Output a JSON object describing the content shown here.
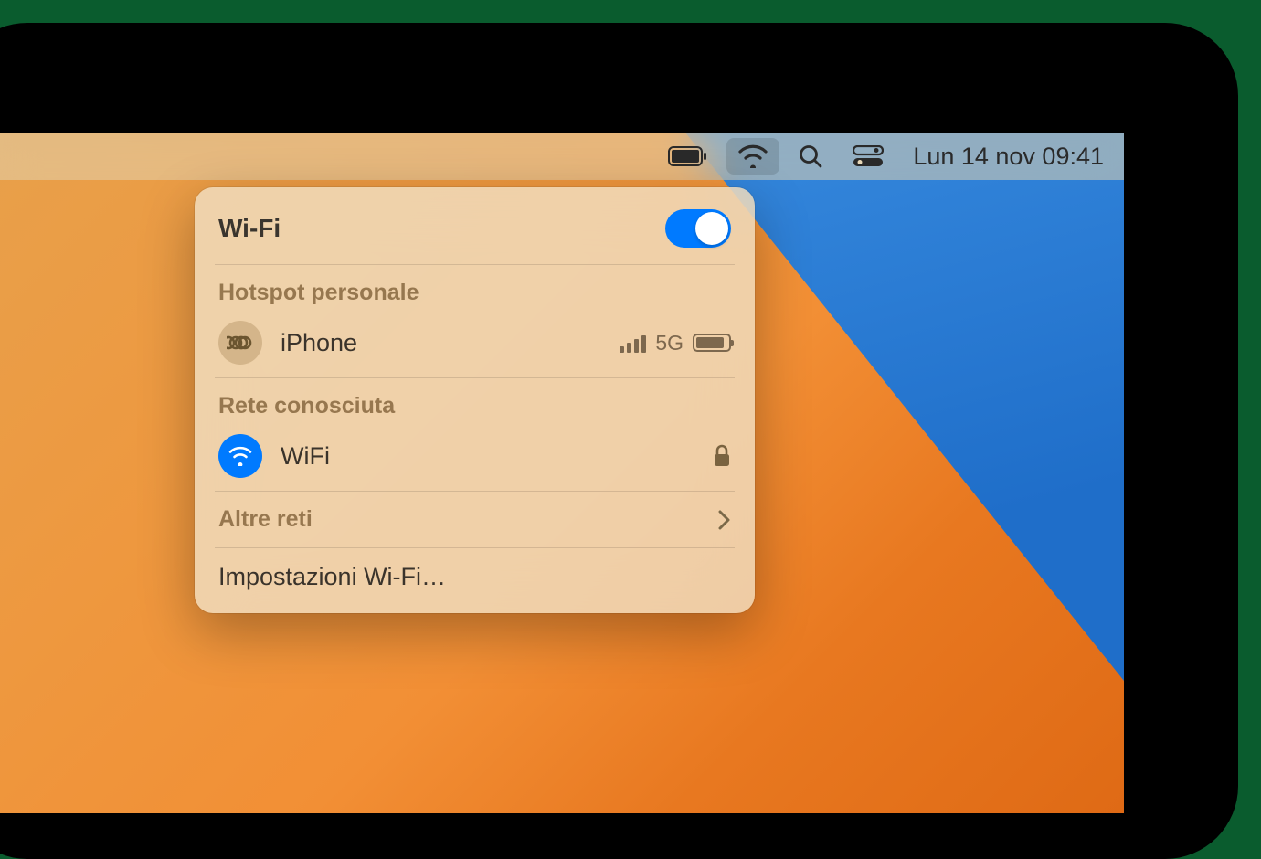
{
  "menubar": {
    "date_time": "Lun 14 nov  09:41"
  },
  "wifi_panel": {
    "title": "Wi-Fi",
    "toggle_on": true,
    "hotspot_section": "Hotspot personale",
    "hotspot_device": "iPhone",
    "hotspot_network_type": "5G",
    "known_section": "Rete conosciuta",
    "known_network": "WiFi",
    "other_networks": "Altre reti",
    "settings": "Impostazioni Wi-Fi…"
  }
}
